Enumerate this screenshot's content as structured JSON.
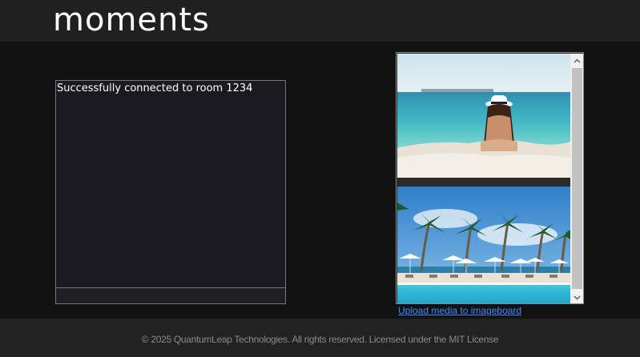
{
  "header": {
    "brand": "moments"
  },
  "chat": {
    "messages": [
      "Successfully connected to room 1234"
    ],
    "input_value": ""
  },
  "imageboard": {
    "items": [
      {
        "kind": "image",
        "subject": "woman in sun hat sitting on sandy beach facing the sea"
      },
      {
        "kind": "image",
        "subject": "palm trees, white parasols and pool by a tropical beach"
      }
    ],
    "upload_label": "Upload media to imageboard"
  },
  "footer": {
    "text": "© 2025 QuantumLeap Technologies. All rights reserved. Licensed under the MIT License"
  },
  "colors": {
    "page_bg": "#121212",
    "header_bg": "#202020",
    "chat_bg": "#1b1a21",
    "link": "#3d8cff",
    "footer_text": "#8a8a8a"
  }
}
